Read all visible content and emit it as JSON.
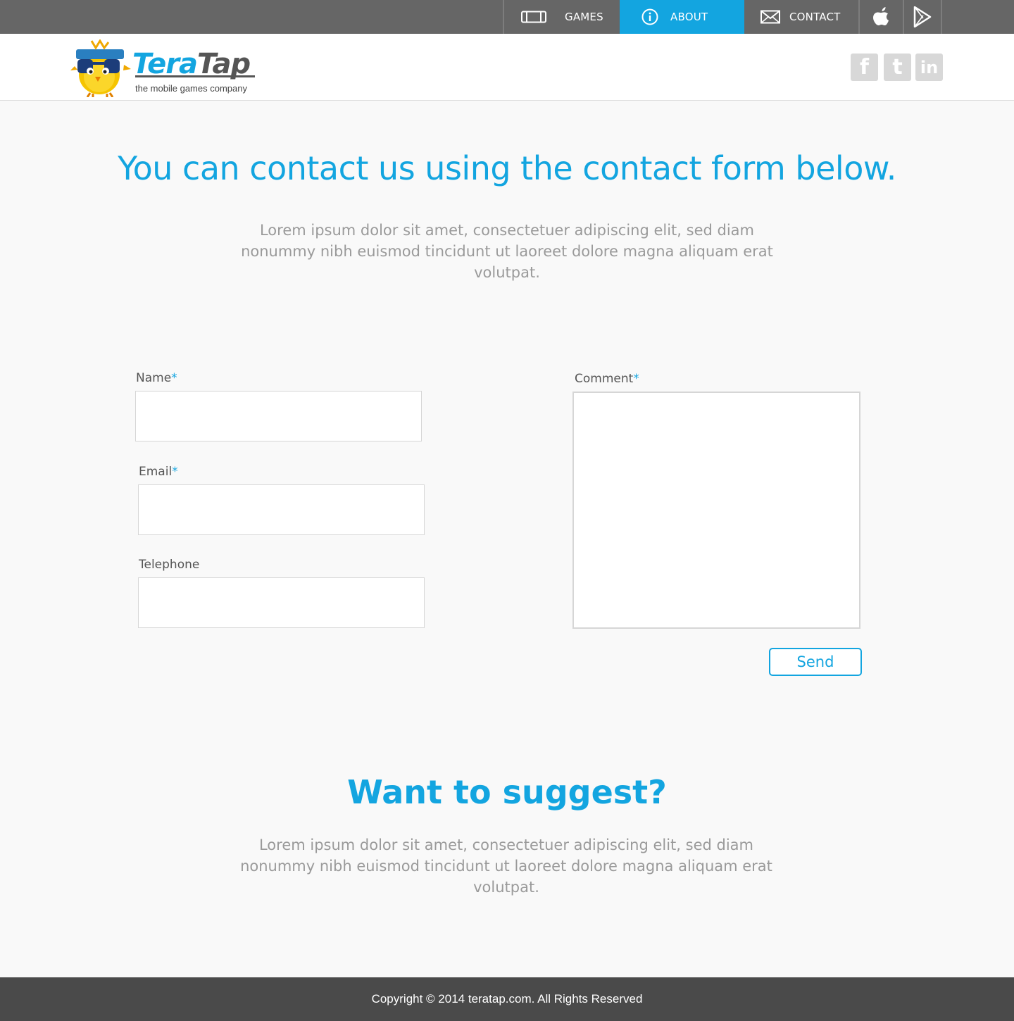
{
  "nav": {
    "games": "GAMES",
    "about": "ABOUT",
    "contact": "CONTACT",
    "active": "about",
    "icons": [
      "gamepad-icon",
      "info-icon",
      "envelope-icon",
      "apple-icon",
      "play-store-icon"
    ]
  },
  "header": {
    "brand_part1": "Tera",
    "brand_part2": "Tap",
    "tagline": "the mobile games company",
    "social": [
      {
        "name": "facebook",
        "glyph": "f"
      },
      {
        "name": "twitter",
        "glyph": "t"
      },
      {
        "name": "linkedin",
        "glyph": "in"
      }
    ]
  },
  "main": {
    "heading": "You can contact us using the contact form below.",
    "lead": "Lorem ipsum dolor sit amet, consectetuer adipiscing elit, sed diam nonummy nibh euismod tincidunt ut laoreet dolore magna aliquam erat volutpat."
  },
  "form": {
    "name_label": "Name",
    "email_label": "Email",
    "telephone_label": "Telephone",
    "comment_label": "Comment",
    "required_mark": "*",
    "name_value": "",
    "email_value": "",
    "telephone_value": "",
    "comment_value": "",
    "send_label": "Send"
  },
  "suggest": {
    "heading": "Want to suggest?",
    "lead": "Lorem ipsum dolor sit amet, consectetuer adipiscing elit, sed diam nonummy nibh euismod tincidunt ut laoreet dolore magna aliquam erat volutpat."
  },
  "footer": {
    "copyright": "Copyright © 2014 teratap.com. All Rights Reserved"
  },
  "colors": {
    "accent": "#13a5e0",
    "topbar": "#666666",
    "footer": "#4a4a4a"
  }
}
